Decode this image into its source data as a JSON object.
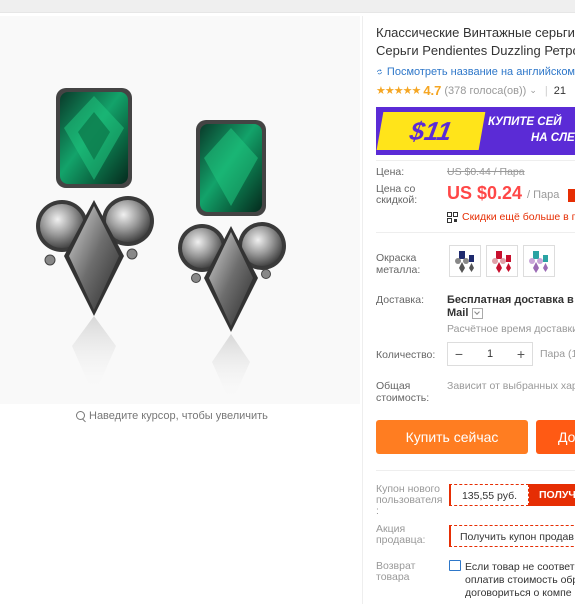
{
  "product": {
    "title_line1": "Классические Винтажные серьги",
    "title_line2": "Серьги Pendientes Duzzling Ретро",
    "translate_link": "Посмотреть название на английском",
    "rating_value": "4.7",
    "votes": "(378 голоса(ов))",
    "orders": "21"
  },
  "gallery": {
    "zoom_hint": "Наведите курсор, чтобы увеличить"
  },
  "banner": {
    "amount": "$11",
    "line1": "КУПИТЕ СЕЙ",
    "line2": "НА СЛЕ"
  },
  "pricing": {
    "price_label": "Цена:",
    "old_price": "US $0.44 / Пара",
    "discount_label": "Цена со скидкой:",
    "price": "US $0.24",
    "unit": "/ Пара",
    "promo_text": "Скидки ещё больше в п"
  },
  "color": {
    "label": "Окраска металла:",
    "options": [
      "navy",
      "red",
      "teal"
    ]
  },
  "shipping": {
    "label": "Доставка:",
    "value_line1": "Бесплатная доставка в R",
    "value_line2": "Mail",
    "eta": "Расчётное время доставки"
  },
  "quantity": {
    "label": "Количество:",
    "value": "1",
    "minus": "−",
    "plus": "+",
    "unit_text": "Пара (1"
  },
  "total": {
    "label": "Общая стоимость:",
    "value": "Зависит от выбранных хар"
  },
  "actions": {
    "buy_now": "Купить сейчас",
    "add_to_cart": "До"
  },
  "coupons": {
    "new_user_label": "Купон нового пользователя :",
    "new_user_amount": "135,55 руб.",
    "new_user_get": "ПОЛУЧИ",
    "seller_label": "Акция продавца:",
    "seller_coupon": "Получить купон продав",
    "return_label": "Возврат товара",
    "return_line1": "Если товар не соответс",
    "return_line2": "оплатив стоимость обр",
    "return_line3": "договориться о компе"
  },
  "colors": {
    "price_red": "#ff4747",
    "buy_orange": "#ff7d21",
    "cart_orange": "#ff5a14",
    "coupon_red": "#e62e04",
    "link_blue": "#2e77c9",
    "banner_purple": "#5b2bd6",
    "banner_yellow": "#ffe41a"
  }
}
